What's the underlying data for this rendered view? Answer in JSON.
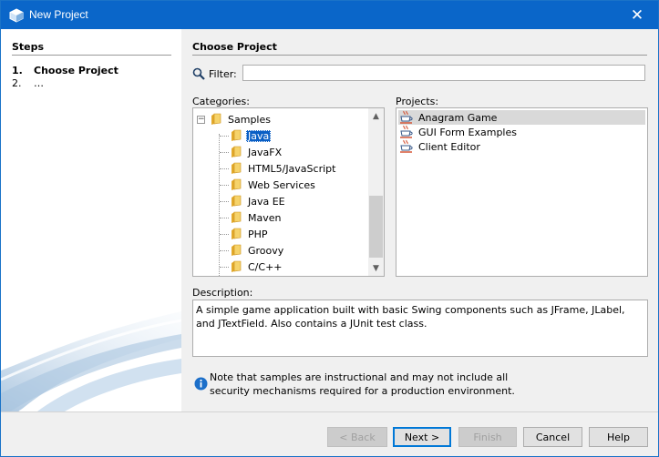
{
  "window": {
    "title": "New Project",
    "close_glyph": "✕"
  },
  "steps": {
    "heading": "Steps",
    "items": [
      {
        "num": "1.",
        "label": "Choose Project"
      },
      {
        "num": "2.",
        "label": "…"
      }
    ]
  },
  "main": {
    "heading": "Choose Project",
    "filter": {
      "label": "Filter:",
      "value": "",
      "placeholder": ""
    },
    "categories_label": "Categories:",
    "projects_label": "Projects:",
    "description_label": "Description:",
    "categories": {
      "root": "Samples",
      "expander_glyph": "−",
      "children": [
        "Java",
        "JavaFX",
        "HTML5/JavaScript",
        "Web Services",
        "Java EE",
        "Maven",
        "PHP",
        "Groovy",
        "C/C++"
      ],
      "selected": "Java"
    },
    "projects": {
      "items": [
        "Anagram Game",
        "GUI Form Examples",
        "Client Editor"
      ],
      "selected": "Anagram Game"
    },
    "description": "A simple game application built with basic Swing components such as JFrame, JLabel, and JTextField. Also contains a JUnit test class.",
    "note_lines": [
      "Note that samples are instructional and may not include all",
      "security mechanisms required for a production environment."
    ]
  },
  "buttons": {
    "back": "< Back",
    "next": "Next >",
    "finish": "Finish",
    "cancel": "Cancel",
    "help": "Help"
  },
  "icons": {
    "app": "netbeans-cube-icon",
    "filter": "magnifier-icon",
    "folder": "folder-icon",
    "project": "java-cup-icon",
    "info": "info-icon"
  },
  "colors": {
    "titlebar": "#0a66c9",
    "selection": "#0a5fc5",
    "project_selection": "#d9d9d9",
    "info_icon": "#1c6fc9"
  }
}
